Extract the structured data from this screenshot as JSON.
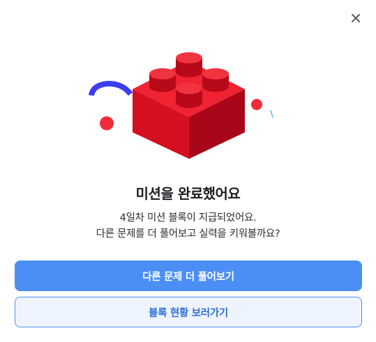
{
  "dialog": {
    "title": "미션을 완료했어요",
    "description_line1": "4일차 미션 블록이 지급되었어요.",
    "description_line2": "다른 문제를 더 풀어보고 실력을 키워볼까요?",
    "primary_button_label": "다른 문제 더 풀어보기",
    "secondary_button_label": "블록 현황 보러가기"
  },
  "icons": {
    "close": "close-icon",
    "illustration": "lego-block-icon"
  },
  "colors": {
    "accent": "#4b8ff5",
    "secondary_text": "#2f6fd6",
    "secondary_bg": "#eef4fe",
    "block_red": "#e8202f",
    "arc_blue": "#3d3df2"
  }
}
